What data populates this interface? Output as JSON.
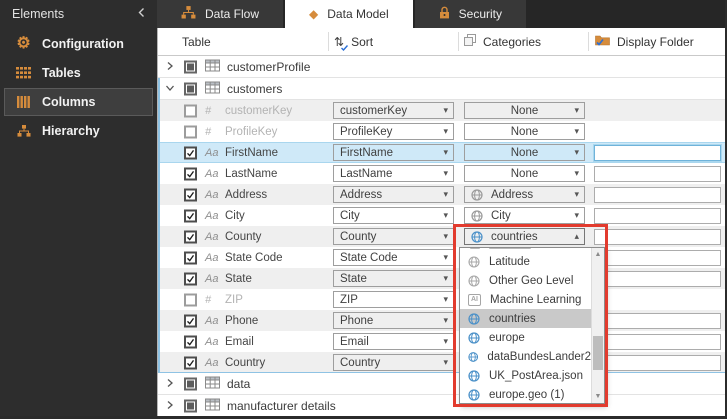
{
  "sidebar": {
    "title": "Elements",
    "items": [
      {
        "label": "Configuration",
        "icon": "gear",
        "selected": false
      },
      {
        "label": "Tables",
        "icon": "table-grid",
        "selected": false
      },
      {
        "label": "Columns",
        "icon": "columns",
        "selected": true
      },
      {
        "label": "Hierarchy",
        "icon": "hierarchy",
        "selected": false
      }
    ]
  },
  "tabs": [
    {
      "label": "Data Flow",
      "icon": "data-flow",
      "active": false
    },
    {
      "label": "Data Model",
      "icon": "diamond",
      "active": true
    },
    {
      "label": "Security",
      "icon": "lock",
      "active": false
    }
  ],
  "grid": {
    "header": {
      "table": "Table",
      "sort": "Sort",
      "categories": "Categories",
      "display_folder": "Display Folder"
    },
    "tables": {
      "customerProfile": {
        "name": "customerProfile",
        "expanded": false,
        "checkbox": "indeterminate"
      },
      "customers": {
        "name": "customers",
        "expanded": true,
        "checkbox": "indeterminate"
      },
      "data": {
        "name": "data",
        "expanded": false,
        "checkbox": "indeterminate"
      },
      "manufacturer": {
        "name": "manufacturer details",
        "expanded": false,
        "checkbox": "indeterminate"
      }
    },
    "columns": [
      {
        "name": "customerKey",
        "type": "#",
        "checked": false,
        "sort": "customerKey",
        "category": "None"
      },
      {
        "name": "ProfileKey",
        "type": "#",
        "checked": false,
        "sort": "ProfileKey",
        "category": "None"
      },
      {
        "name": "FirstName",
        "type": "Aa",
        "checked": true,
        "sort": "FirstName",
        "category": "None",
        "selected_row": true,
        "display_folder": ""
      },
      {
        "name": "LastName",
        "type": "Aa",
        "checked": true,
        "sort": "LastName",
        "category": "None",
        "display_folder": ""
      },
      {
        "name": "Address",
        "type": "Aa",
        "checked": true,
        "sort": "Address",
        "category": "Address",
        "category_icon": "globe-gray",
        "display_folder": ""
      },
      {
        "name": "City",
        "type": "Aa",
        "checked": true,
        "sort": "City",
        "category": "City",
        "category_icon": "globe-gray",
        "display_folder": ""
      },
      {
        "name": "County",
        "type": "Aa",
        "checked": true,
        "sort": "County",
        "category": "countries",
        "category_icon": "globe-blue",
        "category_open": true,
        "display_folder": ""
      },
      {
        "name": "State Code",
        "type": "Aa",
        "checked": true,
        "sort": "State Code",
        "display_folder": ""
      },
      {
        "name": "State",
        "type": "Aa",
        "checked": true,
        "sort": "State",
        "display_folder": ""
      },
      {
        "name": "ZIP",
        "type": "#",
        "checked": false,
        "sort": "ZIP"
      },
      {
        "name": "Phone",
        "type": "Aa",
        "checked": true,
        "sort": "Phone",
        "display_folder": ""
      },
      {
        "name": "Email",
        "type": "Aa",
        "checked": true,
        "sort": "Email",
        "display_folder": ""
      },
      {
        "name": "Country",
        "type": "Aa",
        "checked": true,
        "sort": "Country",
        "display_folder": ""
      }
    ]
  },
  "category_dropdown": {
    "for_row": "County",
    "value": "countries",
    "scrolled": true,
    "items": [
      {
        "label": "Latitude",
        "icon": "globe-gray",
        "selected": false
      },
      {
        "label": "Other Geo Level",
        "icon": "globe-gray",
        "selected": false
      },
      {
        "label": "Machine Learning",
        "icon": "ai-badge",
        "icon_label": "AI",
        "selected": false
      },
      {
        "label": "countries",
        "icon": "globe-blue",
        "selected": true
      },
      {
        "label": "europe",
        "icon": "globe-blue",
        "selected": false
      },
      {
        "label": "dataBundesLander2",
        "icon": "globe-blue",
        "selected": false
      },
      {
        "label": "UK_PostArea.json",
        "icon": "globe-blue",
        "selected": false
      },
      {
        "label": "europe.geo (1)",
        "icon": "globe-blue",
        "selected": false
      }
    ]
  },
  "annotation": {
    "type": "highlight-rectangle",
    "color": "#E23B2E"
  },
  "colors": {
    "accent_orange": "#D68C3C",
    "globe_blue": "#4A90C8",
    "selection_blue": "#CFE9F8",
    "sidebar_dark": "#2D2D2D",
    "row_alt": "#EFEFEF",
    "dropdown_selected": "#C9C9C9"
  }
}
